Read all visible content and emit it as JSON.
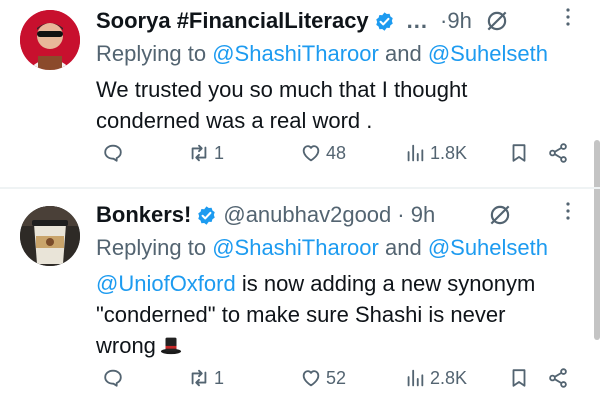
{
  "tweets": [
    {
      "name": "Soorya #FinancialLiteracy",
      "handle": "",
      "truncated": "...",
      "time": "·9h",
      "reply_prefix": "Replying to",
      "reply_mention_1": "@ShashiTharoor",
      "reply_and": "and",
      "reply_mention_2": "@Suhelseth",
      "text_line_1": "We trusted you so much that I thought",
      "text_line_2": "conderned was a real word .",
      "replies": "",
      "retweets": "1",
      "likes": "48",
      "views": "1.8K"
    },
    {
      "name": "Bonkers!",
      "handle": "@anubhav2good",
      "time": "· 9h",
      "reply_prefix": "Replying to",
      "reply_mention_1": "@ShashiTharoor",
      "reply_and": "and",
      "reply_mention_2": "@Suhelseth",
      "text_mention": "@UniofOxford",
      "text_line_1_rest": " is now adding a new synonym",
      "text_line_2": "\"conderned\"  to make sure Shashi is never",
      "text_line_3": "wrong",
      "replies": "",
      "retweets": "1",
      "likes": "52",
      "views": "2.8K"
    }
  ],
  "icons": {
    "verified": "verified-badge-icon",
    "grok": "grok-icon",
    "more": "more-vertical-icon",
    "reply": "reply-icon",
    "retweet": "retweet-icon",
    "like": "heart-icon",
    "views": "views-icon",
    "bookmark": "bookmark-icon",
    "share": "share-icon",
    "emoji": "top-hat-emoji"
  },
  "colors": {
    "link": "#1d9bf0",
    "secondary": "#536471",
    "verified": "#1d9bf0"
  }
}
